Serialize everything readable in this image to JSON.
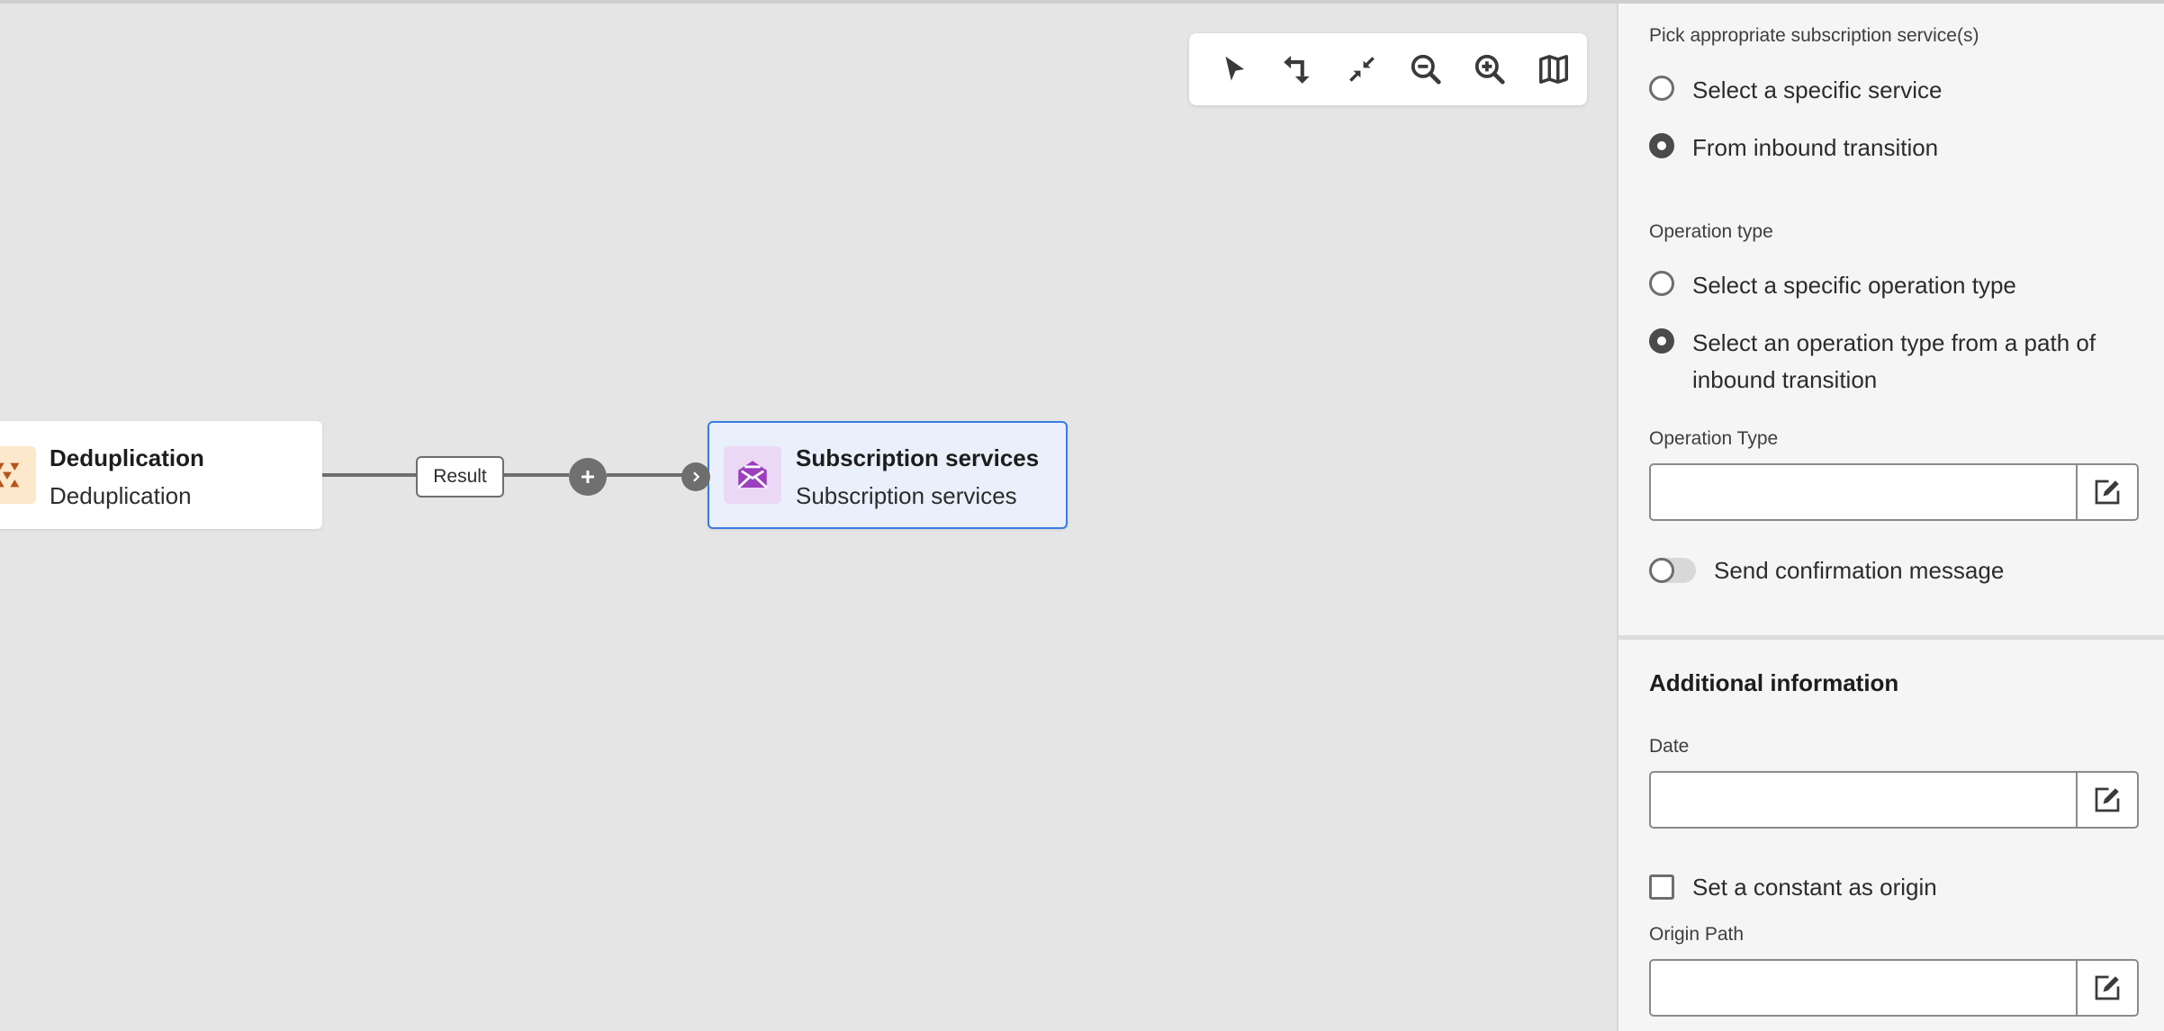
{
  "toolbar": {
    "tools": [
      {
        "icon": "pointer-icon",
        "label": "Select"
      },
      {
        "icon": "rearrange-icon",
        "label": "Rearrange"
      },
      {
        "icon": "fit-to-screen-icon",
        "label": "Fit to screen"
      },
      {
        "icon": "zoom-out-icon",
        "label": "Zoom out"
      },
      {
        "icon": "zoom-in-icon",
        "label": "Zoom in"
      },
      {
        "icon": "map-icon",
        "label": "Map"
      }
    ]
  },
  "canvas": {
    "nodes": [
      {
        "title": "Deduplication",
        "subtitle": "Deduplication",
        "icon": "deduplication-icon",
        "icon_bg": "#fde8cc",
        "icon_color": "#b6541b"
      },
      {
        "title": "Subscription services",
        "subtitle": "Subscription services",
        "icon": "envelope-icon",
        "icon_bg": "#ead8f5",
        "icon_color": "#9b3fbf",
        "selected": true
      }
    ],
    "edge_label": "Result"
  },
  "panel": {
    "subscription_label": "Pick appropriate subscription service(s)",
    "subscription_options": [
      {
        "label": "Select a specific service",
        "checked": false
      },
      {
        "label": "From inbound transition",
        "checked": true
      }
    ],
    "operation_label": "Operation type",
    "operation_options": [
      {
        "label": "Select a specific operation type",
        "checked": false
      },
      {
        "label": "Select an operation type from a path of inbound transition",
        "checked": true
      }
    ],
    "operation_type_field": {
      "label": "Operation Type",
      "value": ""
    },
    "send_confirmation": {
      "label": "Send confirmation message",
      "on": false
    },
    "additional_title": "Additional information",
    "date_field": {
      "label": "Date",
      "value": ""
    },
    "constant_origin": {
      "label": "Set a constant as origin",
      "checked": false
    },
    "origin_path_field": {
      "label": "Origin Path",
      "value": ""
    }
  },
  "colors": {
    "canvas_bg": "#e5e5e5",
    "panel_bg": "#f5f5f5",
    "selection_blue": "#3b7be0"
  }
}
